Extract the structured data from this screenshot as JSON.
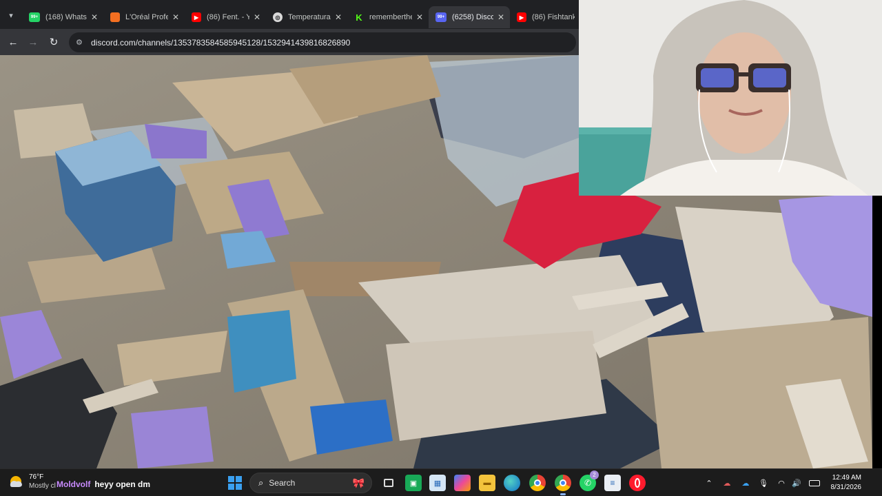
{
  "browser": {
    "tabs": [
      {
        "title": "(168) WhatsA",
        "favicon": "whatsapp-icon",
        "color": "#25d366",
        "glyph": "99+"
      },
      {
        "title": "L'Oréal Profe",
        "favicon": "loreal-icon",
        "color": "#f36f21",
        "glyph": ""
      },
      {
        "title": "(86) Fent. - Yo",
        "favicon": "youtube-icon",
        "color": "#ff0000",
        "glyph": "▶"
      },
      {
        "title": "Temperatura",
        "favicon": "openai-icon",
        "color": "#d9d9d9",
        "glyph": "◎"
      },
      {
        "title": "rememberthe",
        "favicon": "kick-icon",
        "color": "#53fc18",
        "glyph": "K"
      },
      {
        "title": "(6258) Discor",
        "favicon": "discord-icon",
        "color": "#5865f2",
        "glyph": "99+"
      },
      {
        "title": "(86) Fishtank",
        "favicon": "youtube-icon",
        "color": "#ff0000",
        "glyph": "▶"
      }
    ],
    "active_tab": 5,
    "url": "discord.com/channels/1353783584585945128/1532941439816826890"
  },
  "taskbar": {
    "weather": {
      "temp": "76°F",
      "condition": "Mostly cl"
    },
    "chat": {
      "user": "Moldvolf",
      "message": "heyy open dm"
    },
    "search_label": "Search",
    "clock": {
      "time": "12:49 AM",
      "date": "8/31/2026"
    },
    "whatsapp_badge": "2"
  }
}
